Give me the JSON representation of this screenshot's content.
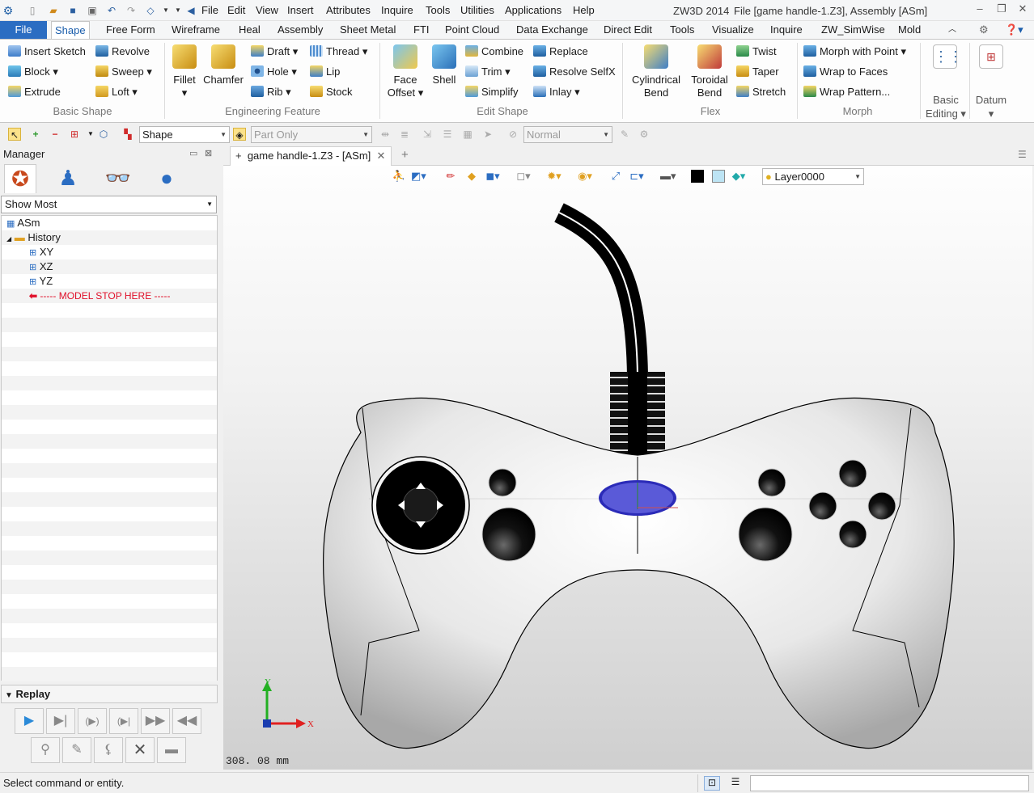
{
  "app": {
    "title": "ZW3D 2014",
    "file_info": "File [game handle-1.Z3],  Assembly [ASm]"
  },
  "menubar": [
    "File",
    "Edit",
    "View",
    "Insert",
    "Attributes",
    "Inquire",
    "Tools",
    "Utilities",
    "Applications",
    "Help"
  ],
  "tabs": [
    "File",
    "Shape",
    "Free Form",
    "Wireframe",
    "Heal",
    "Assembly",
    "Sheet Metal",
    "FTI",
    "Point Cloud",
    "Data Exchange",
    "Direct Edit",
    "Tools",
    "Visualize",
    "Inquire",
    "ZW_SimWise",
    "Mold"
  ],
  "active_tab": "Shape",
  "ribbon": {
    "basic_shape": {
      "label": "Basic Shape",
      "items": [
        "Insert Sketch",
        "Revolve",
        "Block",
        "Sweep",
        "Extrude",
        "Loft"
      ]
    },
    "engineering_feature": {
      "label": "Engineering Feature",
      "big": [
        "Fillet",
        "Chamfer"
      ],
      "items": [
        "Draft",
        "Thread",
        "Hole",
        "Lip",
        "Rib",
        "Stock"
      ]
    },
    "edit_shape": {
      "label": "Edit Shape",
      "big": [
        "Face Offset",
        "Shell"
      ],
      "items": [
        "Combine",
        "Replace",
        "Trim",
        "Resolve SelfX",
        "Simplify",
        "Inlay"
      ]
    },
    "flex": {
      "label": "Flex",
      "big": [
        "Cylindrical Bend",
        "Toroidal Bend"
      ],
      "items": [
        "Twist",
        "Taper",
        "Stretch"
      ]
    },
    "morph": {
      "label": "Morph",
      "items": [
        "Morph with Point",
        "Wrap to Faces",
        "Wrap Pattern..."
      ]
    },
    "basic_editing": {
      "label": "Basic Editing"
    },
    "datum": {
      "label": "Datum"
    }
  },
  "toolbar": {
    "filter_value": "Shape",
    "scope_value": "Part Only",
    "display_value": "Normal"
  },
  "manager": {
    "title": "Manager",
    "filter": "Show Most",
    "tree": [
      {
        "label": "ASm",
        "level": 0
      },
      {
        "label": "History",
        "level": 1
      },
      {
        "label": "XY",
        "level": 2
      },
      {
        "label": "XZ",
        "level": 2
      },
      {
        "label": "YZ",
        "level": 2
      },
      {
        "label": "----- MODEL STOP HERE -----",
        "level": 2
      }
    ],
    "replay_label": "Replay"
  },
  "document_tab": "game handle-1.Z3 - [ASm]",
  "viewport": {
    "layer": "Layer0000",
    "scale_text": "308. 08  mm",
    "axis_x": "X",
    "axis_y": "Y"
  },
  "status": {
    "message": "Select command or entity."
  },
  "colors": {
    "accent": "#2b6dc2",
    "stop_marker": "#e0102a",
    "button_blue": "#5a5ad8"
  }
}
